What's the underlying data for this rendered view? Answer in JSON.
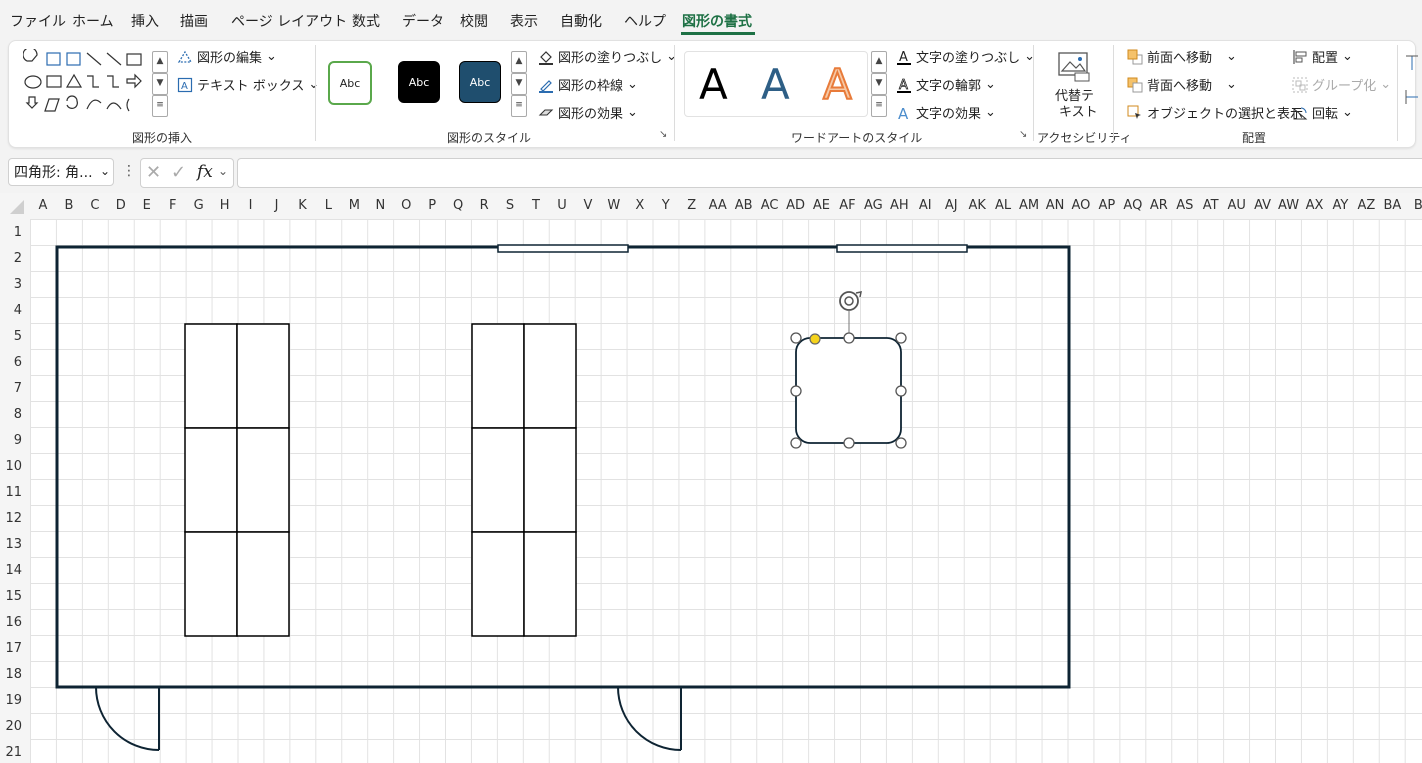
{
  "menu": {
    "tabs": [
      "ファイル",
      "ホーム",
      "挿入",
      "描画",
      "ページ レイアウト",
      "数式",
      "データ",
      "校閲",
      "表示",
      "自動化",
      "ヘルプ",
      "図形の書式"
    ],
    "active_tab": "図形の書式"
  },
  "ribbon": {
    "insert_shapes": {
      "label": "図形の挿入",
      "edit_shape": "図形の編集",
      "text_box": "テキスト ボックス"
    },
    "shape_styles": {
      "label": "図形のスタイル",
      "swatch_text": "Abc",
      "fill": "図形の塗りつぶし",
      "outline": "図形の枠線",
      "effects": "図形の効果",
      "swatch_colors": [
        "#ffffff",
        "#000000",
        "#1f4e6e"
      ]
    },
    "wordart": {
      "label": "ワードアートのスタイル",
      "letter": "A",
      "text_fill": "文字の塗りつぶし",
      "text_outline": "文字の輪郭",
      "text_effects": "文字の効果"
    },
    "accessibility": {
      "label": "アクセシビリティ",
      "alt_text_line1": "代替テ",
      "alt_text_line2": "キスト"
    },
    "arrange": {
      "label": "配置",
      "bring_forward": "前面へ移動",
      "send_backward": "背面へ移動",
      "selection_pane": "オブジェクトの選択と表示",
      "align": "配置",
      "group": "グループ化",
      "rotate": "回転"
    }
  },
  "formula_bar": {
    "name_box": "四角形: 角...",
    "fx": "fx",
    "value": ""
  },
  "sheet": {
    "columns": [
      "A",
      "B",
      "C",
      "D",
      "E",
      "F",
      "G",
      "H",
      "I",
      "J",
      "K",
      "L",
      "M",
      "N",
      "O",
      "P",
      "Q",
      "R",
      "S",
      "T",
      "U",
      "V",
      "W",
      "X",
      "Y",
      "Z",
      "AA",
      "AB",
      "AC",
      "AD",
      "AE",
      "AF",
      "AG",
      "AH",
      "AI",
      "AJ",
      "AK",
      "AL",
      "AM",
      "AN",
      "AO",
      "AP",
      "AQ",
      "AR",
      "AS",
      "AT",
      "AU",
      "AV",
      "AW",
      "AX",
      "AY",
      "AZ",
      "BA",
      "B"
    ],
    "rows": [
      "1",
      "2",
      "3",
      "4",
      "5",
      "6",
      "7",
      "8",
      "9",
      "10",
      "11",
      "12",
      "13",
      "14",
      "15",
      "16",
      "17",
      "18",
      "19",
      "20",
      "21"
    ]
  }
}
